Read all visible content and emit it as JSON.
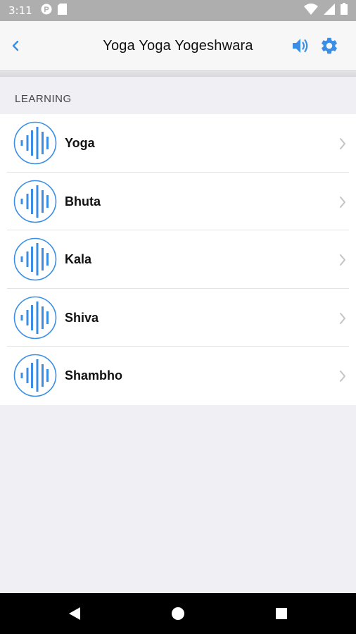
{
  "status_bar": {
    "time": "3:11",
    "left_icons": [
      "p-notification-icon",
      "sim-card-icon"
    ],
    "right_icons": [
      "wifi-icon",
      "cell-signal-icon",
      "battery-icon"
    ]
  },
  "header": {
    "title": "Yoga Yoga Yogeshwara",
    "back_icon": "chevron-left-icon",
    "actions": [
      "speaker-icon",
      "gear-icon"
    ],
    "accent_color": "#3a8ee6"
  },
  "section": {
    "title": "LEARNING"
  },
  "items": [
    {
      "label": "Yoga"
    },
    {
      "label": "Bhuta"
    },
    {
      "label": "Kala"
    },
    {
      "label": "Shiva"
    },
    {
      "label": "Shambho"
    }
  ],
  "nav_bar": {
    "buttons": [
      "back-triangle-icon",
      "home-circle-icon",
      "recents-square-icon"
    ]
  }
}
